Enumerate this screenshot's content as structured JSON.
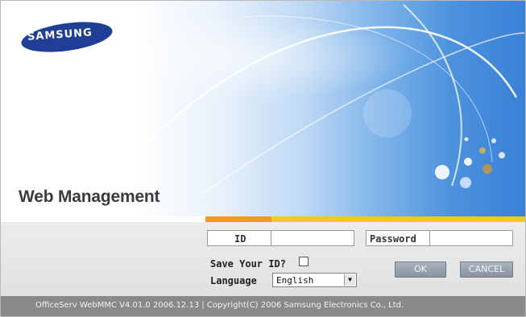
{
  "brand": {
    "logo_text": "SAMSUNG"
  },
  "header": {
    "title": "Web Management"
  },
  "login": {
    "id_label": "ID",
    "id_value": "",
    "password_label": "Password",
    "password_value": "",
    "save_id_label": "Save Your ID?",
    "save_id_checked": false,
    "language_label": "Language",
    "language_selected": "English",
    "ok_label": "OK",
    "cancel_label": "CANCEL"
  },
  "footer": {
    "text": "OfficeServ WebMMC V4.01.0 2006.12.13 | Copyright(C) 2006 Samsung Electronics Co., Ltd."
  },
  "colors": {
    "accent_orange": "#f39a1e",
    "accent_yellow": "#f6c822",
    "brand_blue": "#1f3e95",
    "footer_gray": "#898989"
  }
}
